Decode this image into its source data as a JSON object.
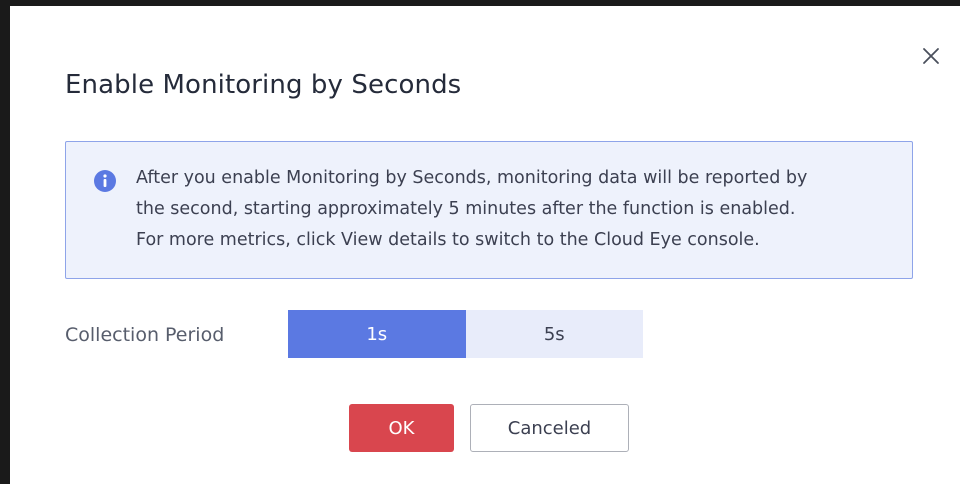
{
  "dialog": {
    "title": "Enable Monitoring by Seconds",
    "close_icon": "close-icon"
  },
  "alert": {
    "icon": "info-icon",
    "lines": [
      "After you enable Monitoring by Seconds, monitoring data will be reported by",
      "the second, starting approximately 5 minutes after the function is enabled.",
      "For more metrics, click View details to switch to the Cloud Eye console."
    ]
  },
  "collection_period": {
    "label": "Collection Period",
    "options": [
      "1s",
      "5s"
    ],
    "selected": "1s"
  },
  "footer": {
    "ok_label": "OK",
    "cancel_label": "Canceled"
  },
  "colors": {
    "primary": "#5b79e2",
    "danger": "#d9464e",
    "alert_bg": "#eef2fc",
    "alert_border": "#8ea4e9"
  }
}
